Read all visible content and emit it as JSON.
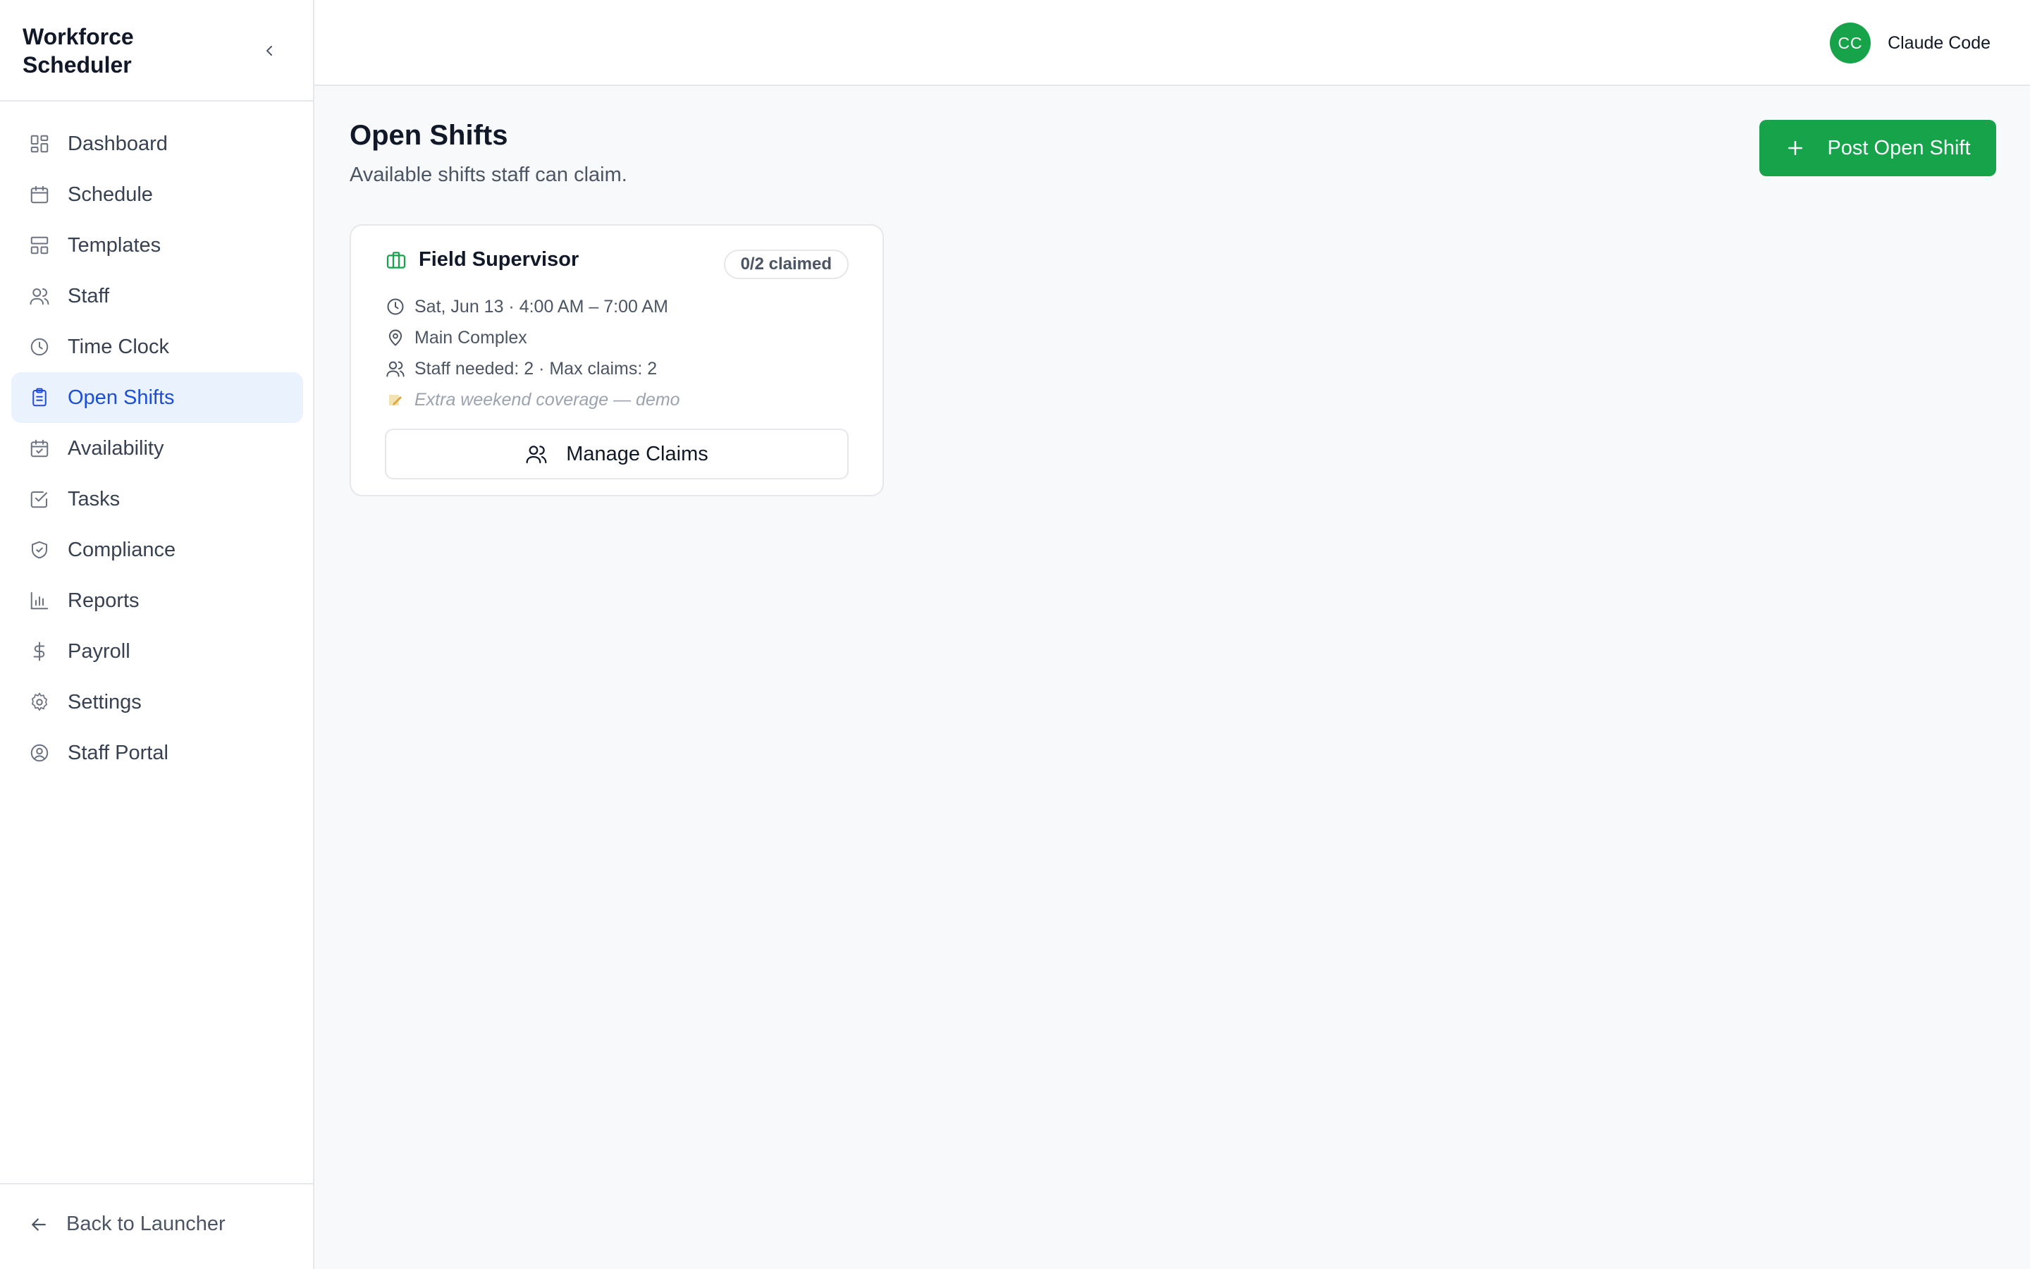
{
  "app": {
    "title": "Workforce Scheduler"
  },
  "sidebar": {
    "items": [
      {
        "label": "Dashboard",
        "icon": "dashboard-icon",
        "active": false
      },
      {
        "label": "Schedule",
        "icon": "calendar-icon",
        "active": false
      },
      {
        "label": "Templates",
        "icon": "template-icon",
        "active": false
      },
      {
        "label": "Staff",
        "icon": "users-icon",
        "active": false
      },
      {
        "label": "Time Clock",
        "icon": "clock-icon",
        "active": false
      },
      {
        "label": "Open Shifts",
        "icon": "clipboard-icon",
        "active": true
      },
      {
        "label": "Availability",
        "icon": "calendar-check-icon",
        "active": false
      },
      {
        "label": "Tasks",
        "icon": "checkbox-icon",
        "active": false
      },
      {
        "label": "Compliance",
        "icon": "shield-check-icon",
        "active": false
      },
      {
        "label": "Reports",
        "icon": "bar-chart-icon",
        "active": false
      },
      {
        "label": "Payroll",
        "icon": "dollar-icon",
        "active": false
      },
      {
        "label": "Settings",
        "icon": "gear-icon",
        "active": false
      },
      {
        "label": "Staff Portal",
        "icon": "user-circle-icon",
        "active": false
      }
    ],
    "footer": {
      "back_label": "Back to Launcher"
    }
  },
  "header": {
    "user": {
      "initials": "CC",
      "name": "Claude Code",
      "avatar_color": "#16a34a"
    }
  },
  "page": {
    "title": "Open Shifts",
    "subtitle": "Available shifts staff can claim.",
    "post_button_label": "Post Open Shift"
  },
  "shifts": [
    {
      "role": "Field Supervisor",
      "claimed": "0/2 claimed",
      "datetime": "Sat, Jun 13 · 4:00 AM – 7:00 AM",
      "location": "Main Complex",
      "staffing": "Staff needed: 2 · Max claims: 2",
      "note": "Extra weekend coverage — demo",
      "manage_label": "Manage Claims"
    }
  ],
  "colors": {
    "accent_green": "#16a34a",
    "active_nav_bg": "#eaf2fe",
    "active_nav_text": "#1d4ed8"
  }
}
